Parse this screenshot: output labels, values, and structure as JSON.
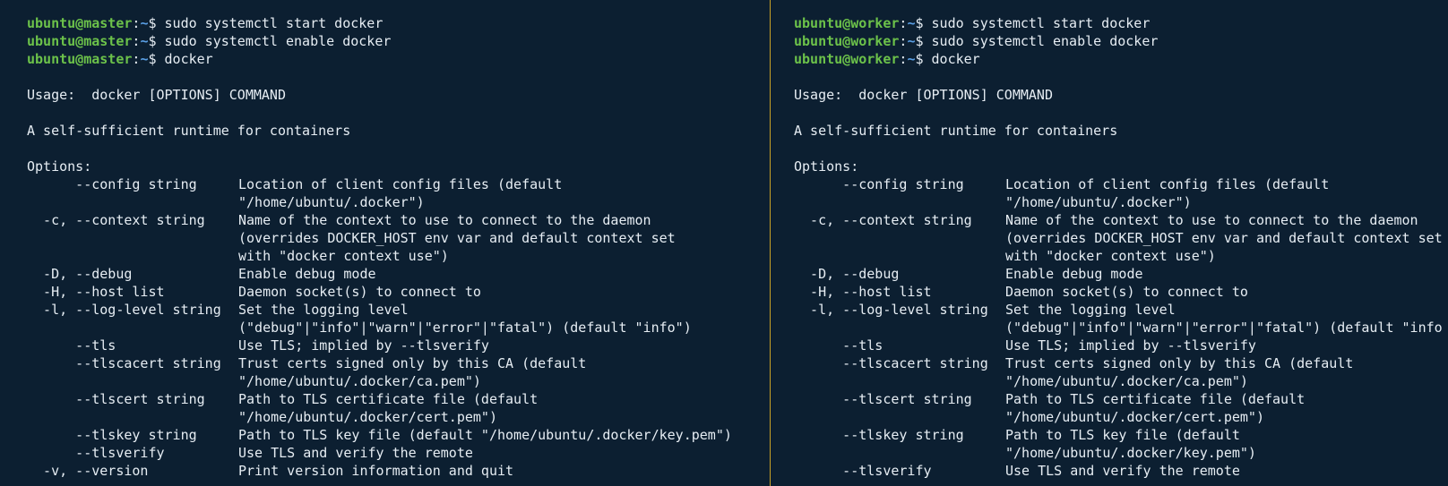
{
  "left": {
    "prompt_user": "ubuntu@master",
    "prompt_path": "~",
    "commands": [
      "sudo systemctl start docker",
      "sudo systemctl enable docker",
      "docker"
    ],
    "usage": "Usage:  docker [OPTIONS] COMMAND",
    "description": "A self-sufficient runtime for containers",
    "options_header": "Options:",
    "options": [
      {
        "flag": "      --config string",
        "desc": "Location of client config files (default"
      },
      {
        "flag": "",
        "desc": "\"/home/ubuntu/.docker\")"
      },
      {
        "flag": "  -c, --context string",
        "desc": "Name of the context to use to connect to the daemon"
      },
      {
        "flag": "",
        "desc": "(overrides DOCKER_HOST env var and default context set"
      },
      {
        "flag": "",
        "desc": "with \"docker context use\")"
      },
      {
        "flag": "  -D, --debug",
        "desc": "Enable debug mode"
      },
      {
        "flag": "  -H, --host list",
        "desc": "Daemon socket(s) to connect to"
      },
      {
        "flag": "  -l, --log-level string",
        "desc": "Set the logging level"
      },
      {
        "flag": "",
        "desc": "(\"debug\"|\"info\"|\"warn\"|\"error\"|\"fatal\") (default \"info\")"
      },
      {
        "flag": "      --tls",
        "desc": "Use TLS; implied by --tlsverify"
      },
      {
        "flag": "      --tlscacert string",
        "desc": "Trust certs signed only by this CA (default"
      },
      {
        "flag": "",
        "desc": "\"/home/ubuntu/.docker/ca.pem\")"
      },
      {
        "flag": "      --tlscert string",
        "desc": "Path to TLS certificate file (default"
      },
      {
        "flag": "",
        "desc": "\"/home/ubuntu/.docker/cert.pem\")"
      },
      {
        "flag": "      --tlskey string",
        "desc": "Path to TLS key file (default \"/home/ubuntu/.docker/key.pem\")"
      },
      {
        "flag": "      --tlsverify",
        "desc": "Use TLS and verify the remote"
      },
      {
        "flag": "  -v, --version",
        "desc": "Print version information and quit"
      }
    ]
  },
  "right": {
    "prompt_user": "ubuntu@worker",
    "prompt_path": "~",
    "commands": [
      "sudo systemctl start docker",
      "sudo systemctl enable docker",
      "docker"
    ],
    "usage": "Usage:  docker [OPTIONS] COMMAND",
    "description": "A self-sufficient runtime for containers",
    "options_header": "Options:",
    "options": [
      {
        "flag": "      --config string",
        "desc": "Location of client config files (default"
      },
      {
        "flag": "",
        "desc": "\"/home/ubuntu/.docker\")"
      },
      {
        "flag": "  -c, --context string",
        "desc": "Name of the context to use to connect to the daemon"
      },
      {
        "flag": "",
        "desc": "(overrides DOCKER_HOST env var and default context set"
      },
      {
        "flag": "",
        "desc": "with \"docker context use\")"
      },
      {
        "flag": "  -D, --debug",
        "desc": "Enable debug mode"
      },
      {
        "flag": "  -H, --host list",
        "desc": "Daemon socket(s) to connect to"
      },
      {
        "flag": "  -l, --log-level string",
        "desc": "Set the logging level"
      },
      {
        "flag": "",
        "desc": "(\"debug\"|\"info\"|\"warn\"|\"error\"|\"fatal\") (default \"info"
      },
      {
        "flag": "      --tls",
        "desc": "Use TLS; implied by --tlsverify"
      },
      {
        "flag": "      --tlscacert string",
        "desc": "Trust certs signed only by this CA (default"
      },
      {
        "flag": "",
        "desc": "\"/home/ubuntu/.docker/ca.pem\")"
      },
      {
        "flag": "      --tlscert string",
        "desc": "Path to TLS certificate file (default"
      },
      {
        "flag": "",
        "desc": "\"/home/ubuntu/.docker/cert.pem\")"
      },
      {
        "flag": "      --tlskey string",
        "desc": "Path to TLS key file (default"
      },
      {
        "flag": "",
        "desc": "\"/home/ubuntu/.docker/key.pem\")"
      },
      {
        "flag": "      --tlsverify",
        "desc": "Use TLS and verify the remote"
      }
    ]
  },
  "colors": {
    "background": "#0c1f31",
    "text": "#e6edf3",
    "prompt_user": "#6cc24a",
    "prompt_path": "#5aa0e6",
    "divider": "#c9a227"
  }
}
